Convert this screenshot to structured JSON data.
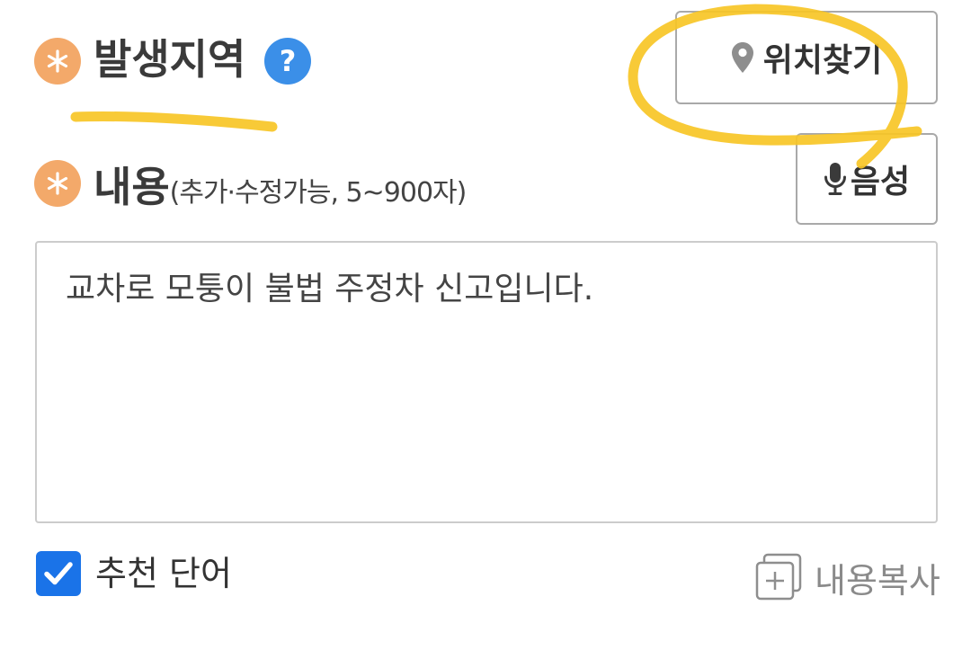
{
  "location": {
    "label": "발생지역",
    "help_symbol": "?",
    "find_button_label": "위치찾기"
  },
  "content": {
    "label": "내용",
    "hint": "(추가·수정가능, 5~900자)",
    "voice_button_label": "음성",
    "text_value": "교차로 모퉁이 불법 주정차 신고입니다."
  },
  "options": {
    "recommend_words_label": "추천 단어",
    "recommend_words_checked": true,
    "copy_content_label": "내용복사"
  },
  "colors": {
    "required_badge": "#f3a96a",
    "help_badge": "#3b8fe8",
    "checkbox": "#1a73e8",
    "annotation_marker": "#f7c526"
  }
}
